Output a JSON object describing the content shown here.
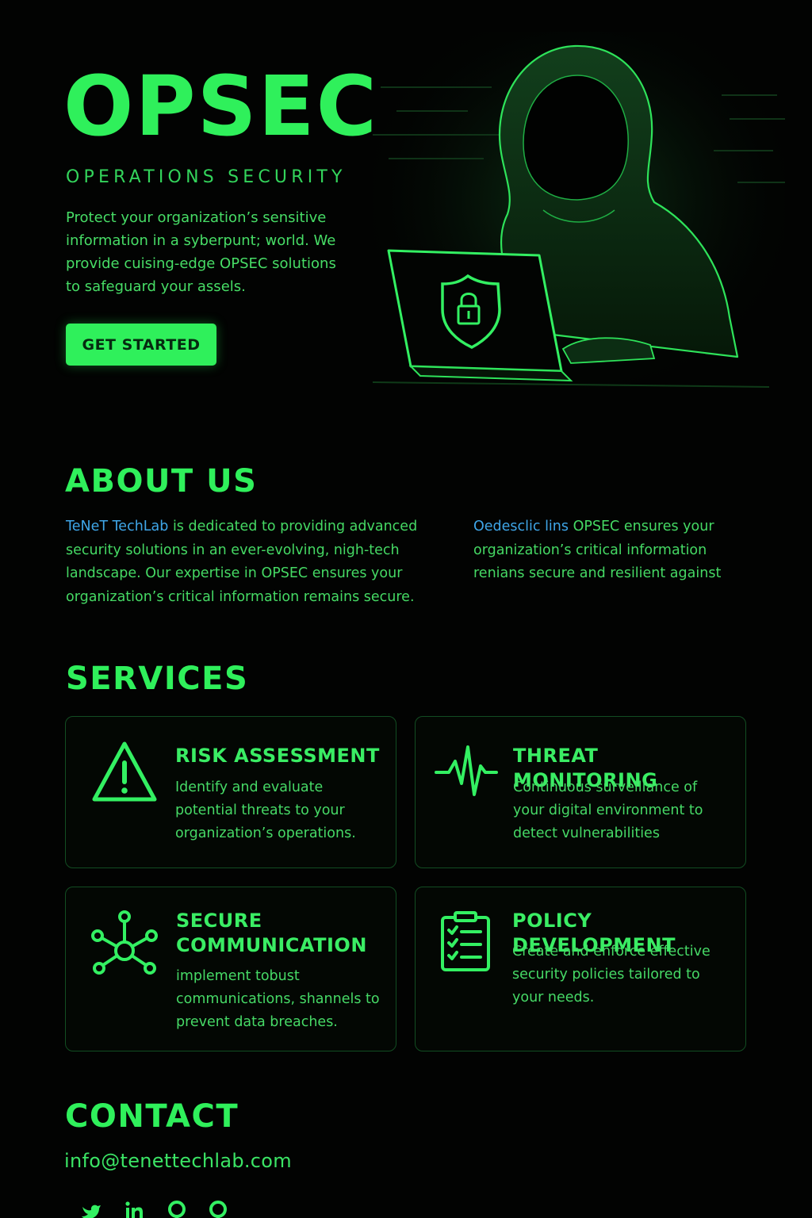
{
  "hero": {
    "title": "OPSEC",
    "subtitle": "OPERATIONS SECURITY",
    "description": "Protect your organization’s sensitive information in a syberpunt; world. We provide cuising-edge OPSEC solutions to safeguard your assels.",
    "cta_label": "GET STARTED"
  },
  "about": {
    "heading": "ABOUT US",
    "col1_highlight": "TeNeT TechLab",
    "col1_text": " is dedicated to providing advanced security solutions in an ever-evolving, nigh-tech landscape. Our expertise in OPSEC ensures your organization’s critical information remains secure.",
    "col2_highlight": "Oedesclic lins",
    "col2_text": " OPSEC ensures your organization’s critical information renians secure and resilient against"
  },
  "services": {
    "heading": "SERVICES",
    "items": [
      {
        "title": "RISK ASSESSMENT",
        "description": "Identify and evaluate potential threats to your organization’s operations.",
        "icon": "warning-triangle-icon"
      },
      {
        "title": "THREAT MONITORING",
        "description": "Continuous surveillance of your digital environment to detect vulnerabilities",
        "icon": "heartbeat-pulse-icon"
      },
      {
        "title": "SECURE COMMUNICATION",
        "description": "implement tobust communications, shannels to prevent data breaches.",
        "icon": "network-hub-icon"
      },
      {
        "title": "POLICY DEVELOPMENT",
        "description": "Create and enforce effective security policies tailored to your needs.",
        "icon": "clipboard-checklist-icon"
      }
    ]
  },
  "contact": {
    "heading": "CONTACT",
    "email": "info@tenettechlab.com",
    "social_icons": [
      "twitter-bird-icon",
      "linkedin-icon",
      "github-icon",
      "github-icon"
    ]
  },
  "colors": {
    "accent": "#2ff05b",
    "background": "#020302",
    "link": "#3fa6e8",
    "card_border": "#124d22"
  }
}
